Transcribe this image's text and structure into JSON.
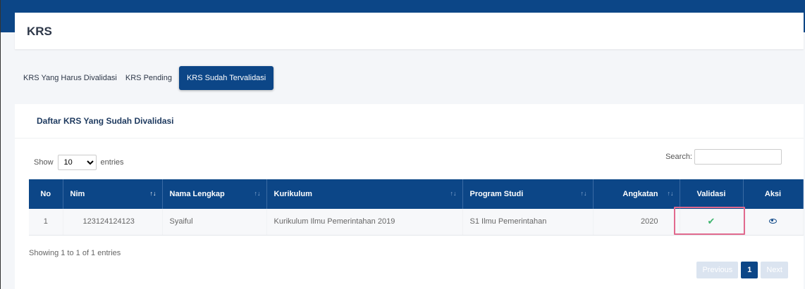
{
  "page": {
    "title": "KRS"
  },
  "tabs": [
    {
      "label": "KRS Yang Harus Divalidasi"
    },
    {
      "label": "KRS Pending"
    },
    {
      "label": "KRS Sudah Tervalidasi"
    }
  ],
  "card": {
    "title": "Daftar KRS Yang Sudah Divalidasi"
  },
  "length": {
    "show_label": "Show",
    "value": "10",
    "entries_label": "entries"
  },
  "search": {
    "label": "Search:",
    "value": ""
  },
  "table": {
    "columns": [
      "No",
      "Nim",
      "Nama Lengkap",
      "Kurikulum",
      "Program Studi",
      "Angkatan",
      "Validasi",
      "Aksi"
    ],
    "rows": [
      {
        "no": "1",
        "nim": "123124124123",
        "nama": "Syaiful",
        "kurikulum": "Kurikulum Ilmu Pemerintahan 2019",
        "prodi": "S1 Ilmu Pemerintahan",
        "angkatan": "2020",
        "validasi_icon": "check-icon",
        "aksi_icon": "eye-icon"
      }
    ]
  },
  "info": "Showing 1 to 1 of 1 entries",
  "pagination": {
    "previous": "Previous",
    "current": "1",
    "next": "Next"
  },
  "colors": {
    "primary": "#0c4687",
    "highlight": "#e26a8e",
    "success": "#3db46d"
  }
}
